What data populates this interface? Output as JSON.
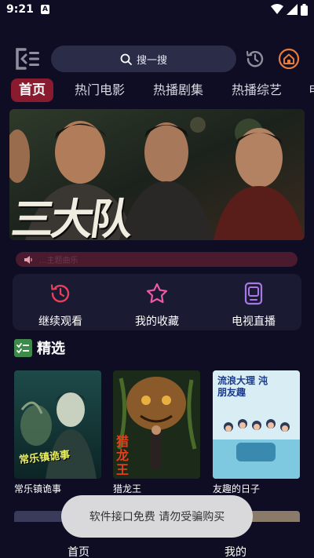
{
  "status_bar": {
    "time": "9:21",
    "notification_letter": "A",
    "icons": [
      "wifi-icon",
      "signal-icon",
      "battery-icon"
    ]
  },
  "header": {
    "search": {
      "placeholder": "搜一搜",
      "icon": "search-icon"
    },
    "left_icon": "menu-list-icon",
    "right_icons": [
      "history-icon",
      "home-icon"
    ]
  },
  "tabs": [
    {
      "label": "首页",
      "active": true
    },
    {
      "label": "热门电影",
      "active": false
    },
    {
      "label": "热播剧集",
      "active": false
    },
    {
      "label": "热播综艺",
      "active": false
    },
    {
      "label": "电",
      "active": false
    }
  ],
  "banner": {
    "title_art": "三大队"
  },
  "notice": {
    "text": "...主题曲乐",
    "icon": "speaker-icon"
  },
  "quick_actions": [
    {
      "label": "继续观看",
      "icon": "history-icon",
      "color": "#e8405a"
    },
    {
      "label": "我的收藏",
      "icon": "star-icon",
      "color": "#e85aa6"
    },
    {
      "label": "电视直播",
      "icon": "tv-icon",
      "color": "#a877e6"
    }
  ],
  "section": {
    "title": "精选",
    "icon": "checklist-icon"
  },
  "cards": [
    {
      "title": "常乐镇诡事",
      "poster_text": "常乐镇诡事"
    },
    {
      "title": "猎龙王",
      "poster_text": "猎龙王"
    },
    {
      "title": "友趣的日子",
      "poster_text": "流浪大理 沌朋友趣"
    }
  ],
  "bottom_nav": [
    {
      "label": "首页",
      "active": true
    },
    {
      "label": "我的",
      "active": false
    }
  ],
  "toast": {
    "text": "软件接口免费 请勿受骗购买"
  },
  "colors": {
    "background": "#0f0d24",
    "accent": "#8a1b2e",
    "surface": "#1b1a33",
    "search_bg": "#2a2c48",
    "toast_bg": "#d9d9dc"
  }
}
